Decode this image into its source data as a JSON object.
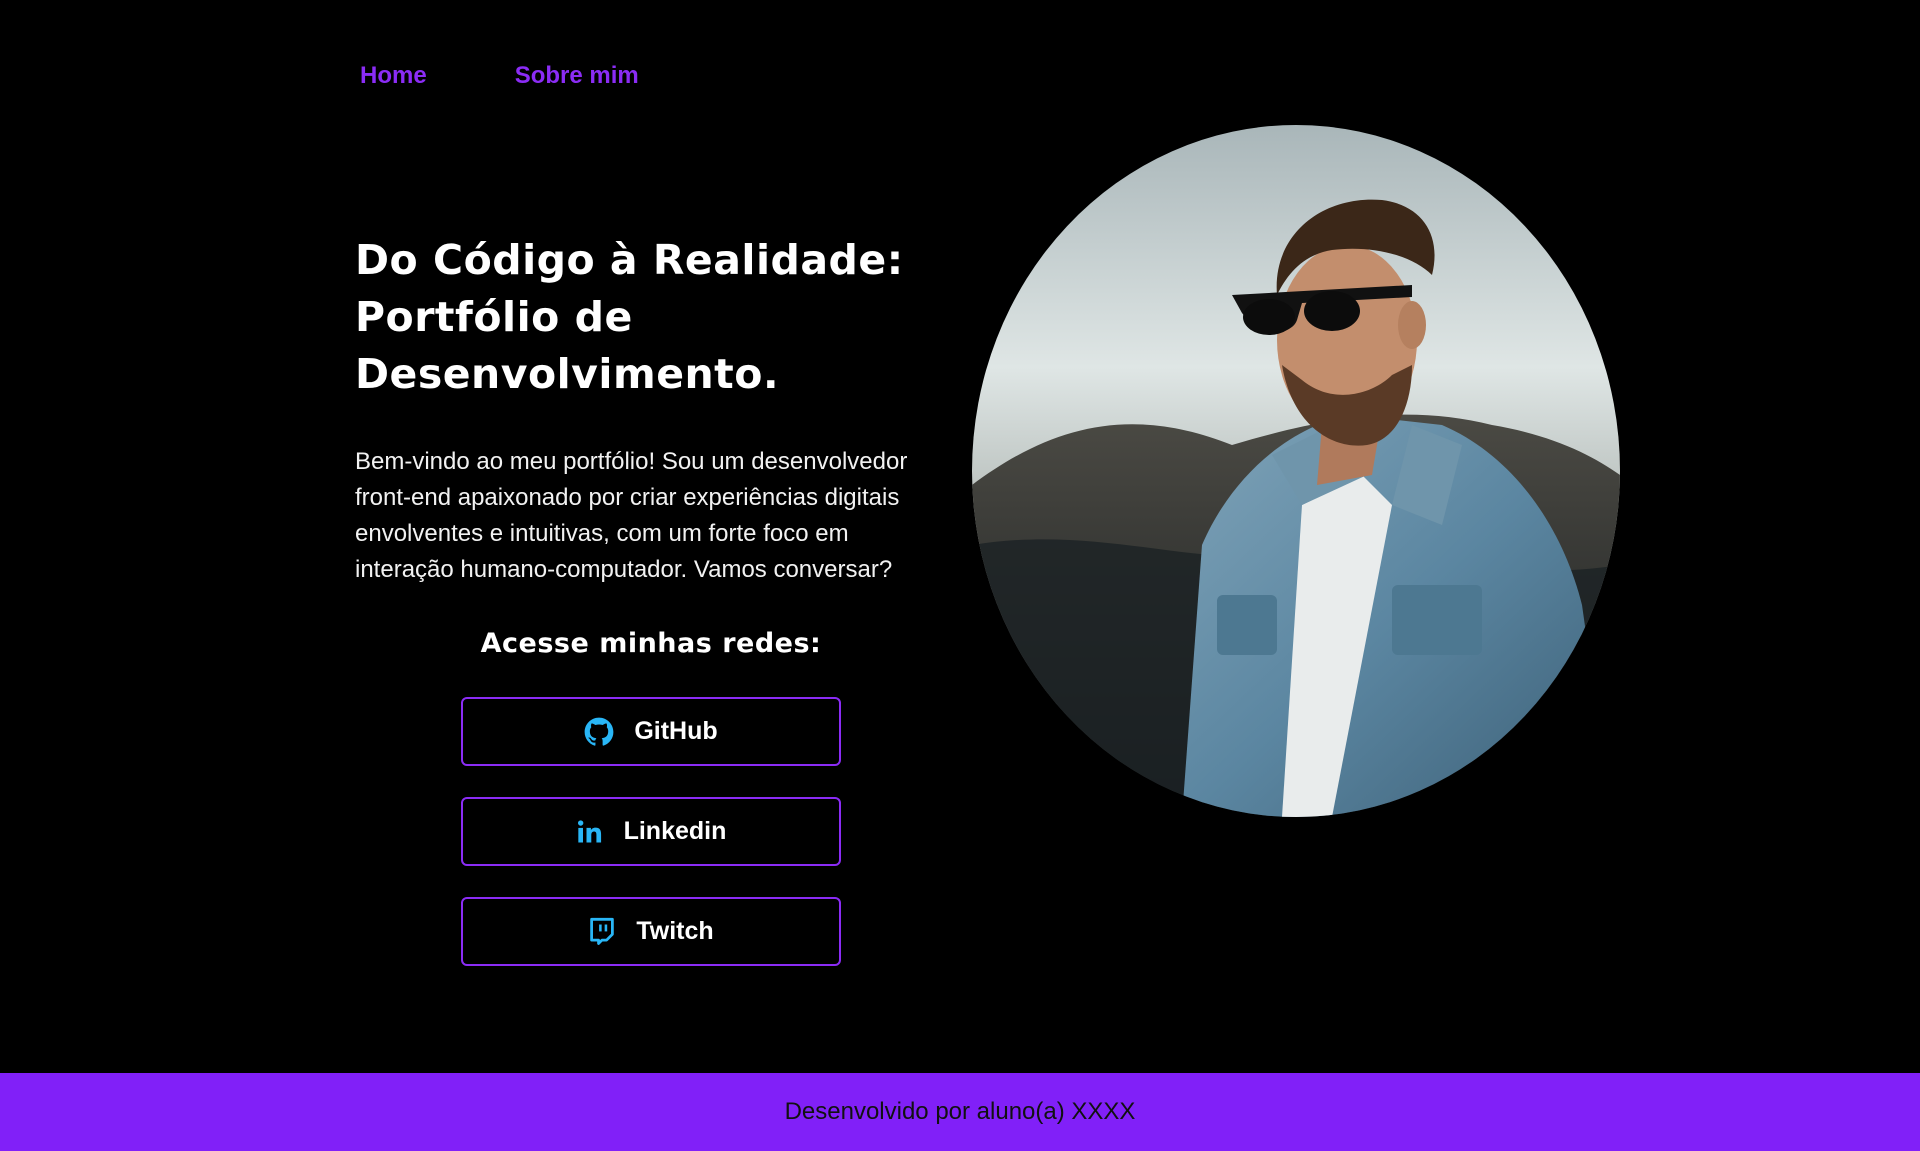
{
  "nav": {
    "items": [
      {
        "label": "Home"
      },
      {
        "label": "Sobre mim"
      }
    ]
  },
  "hero": {
    "title_lines": [
      "Do Código à Realidade:",
      "Portfólio de",
      "Desenvolvimento."
    ],
    "description": "Bem-vindo ao meu portfólio! Sou um desenvolvedor front-end apaixonado por criar experiências digitais envolventes e intuitivas, com um forte foco em interação humano-computador. Vamos conversar?",
    "image_alt": "Homem de óculos escuros e jaqueta jeans"
  },
  "social": {
    "heading": "Acesse minhas redes:",
    "buttons": [
      {
        "label": "GitHub",
        "icon": "github-icon"
      },
      {
        "label": "Linkedin",
        "icon": "linkedin-icon"
      },
      {
        "label": "Twitch",
        "icon": "twitch-icon"
      }
    ]
  },
  "footer": {
    "text": "Desenvolvido por aluno(a) XXXX"
  },
  "colors": {
    "background": "#000000",
    "accent": "#8b2cf5",
    "footer_bg": "#8120f8",
    "icon": "#29b6f6"
  }
}
